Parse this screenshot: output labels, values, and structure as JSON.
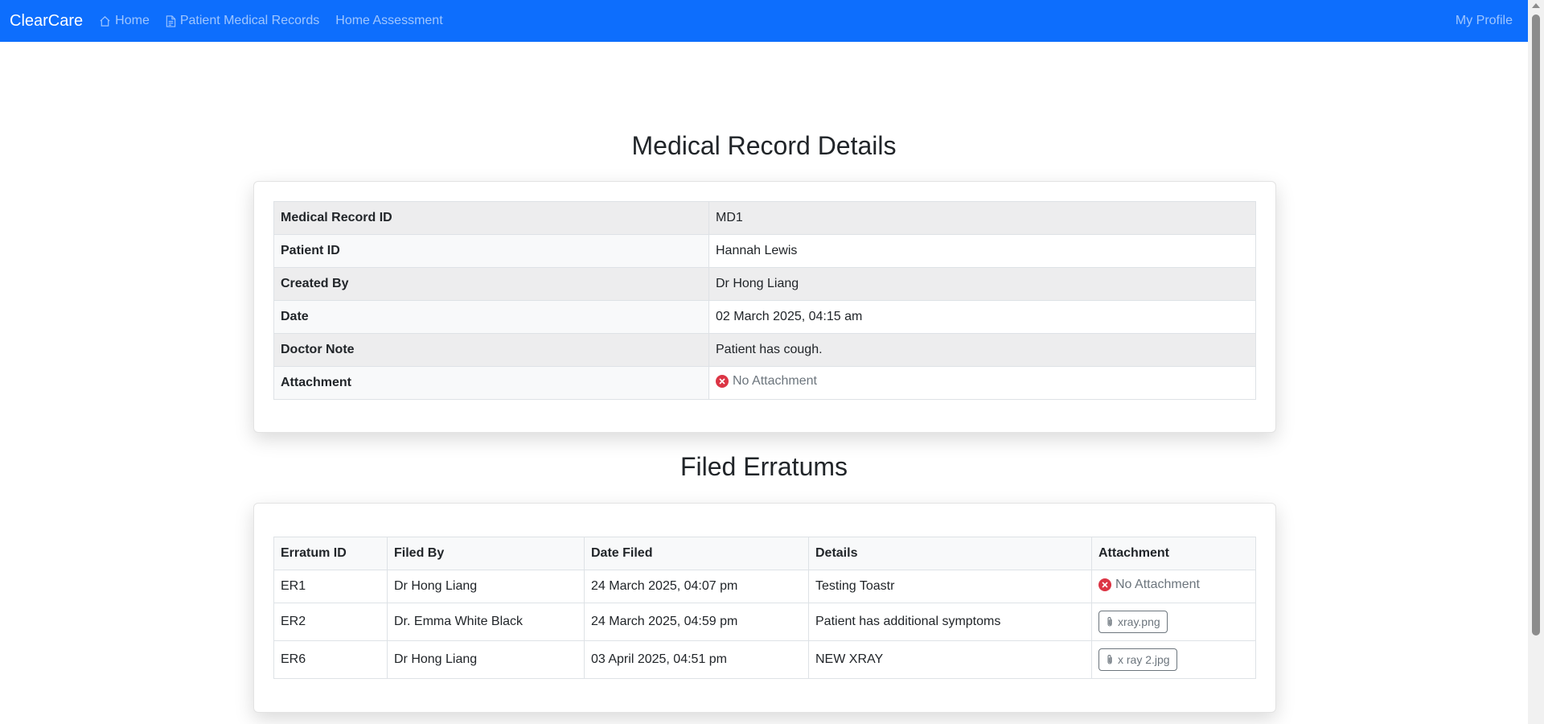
{
  "nav": {
    "brand": "ClearCare",
    "home": "Home",
    "records": "Patient Medical Records",
    "assessment": "Home Assessment",
    "profile": "My Profile"
  },
  "record": {
    "title": "Medical Record Details",
    "rows": [
      {
        "label": "Medical Record ID",
        "value": "MD1"
      },
      {
        "label": "Patient ID",
        "value": "Hannah Lewis"
      },
      {
        "label": "Created By",
        "value": "Dr Hong Liang"
      },
      {
        "label": "Date",
        "value": "02 March 2025, 04:15 am"
      },
      {
        "label": "Doctor Note",
        "value": "Patient has cough."
      },
      {
        "label": "Attachment",
        "value": "No Attachment"
      }
    ]
  },
  "errata": {
    "title": "Filed Erratums",
    "headers": [
      "Erratum ID",
      "Filed By",
      "Date Filed",
      "Details",
      "Attachment"
    ],
    "rows": [
      {
        "id": "ER1",
        "by": "Dr Hong Liang",
        "date": "24 March 2025, 04:07 pm",
        "details": "Testing Toastr",
        "attachment": "No Attachment"
      },
      {
        "id": "ER2",
        "by": "Dr. Emma White Black",
        "date": "24 March 2025, 04:59 pm",
        "details": "Patient has additional symptoms",
        "attachment": "xray.png"
      },
      {
        "id": "ER6",
        "by": "Dr Hong Liang",
        "date": "03 April 2025, 04:51 pm",
        "details": "NEW XRAY",
        "attachment": "x ray 2.jpg"
      }
    ]
  },
  "colors": {
    "primary": "#0d6efd",
    "danger": "#dc3545",
    "muted": "#6c757d"
  }
}
